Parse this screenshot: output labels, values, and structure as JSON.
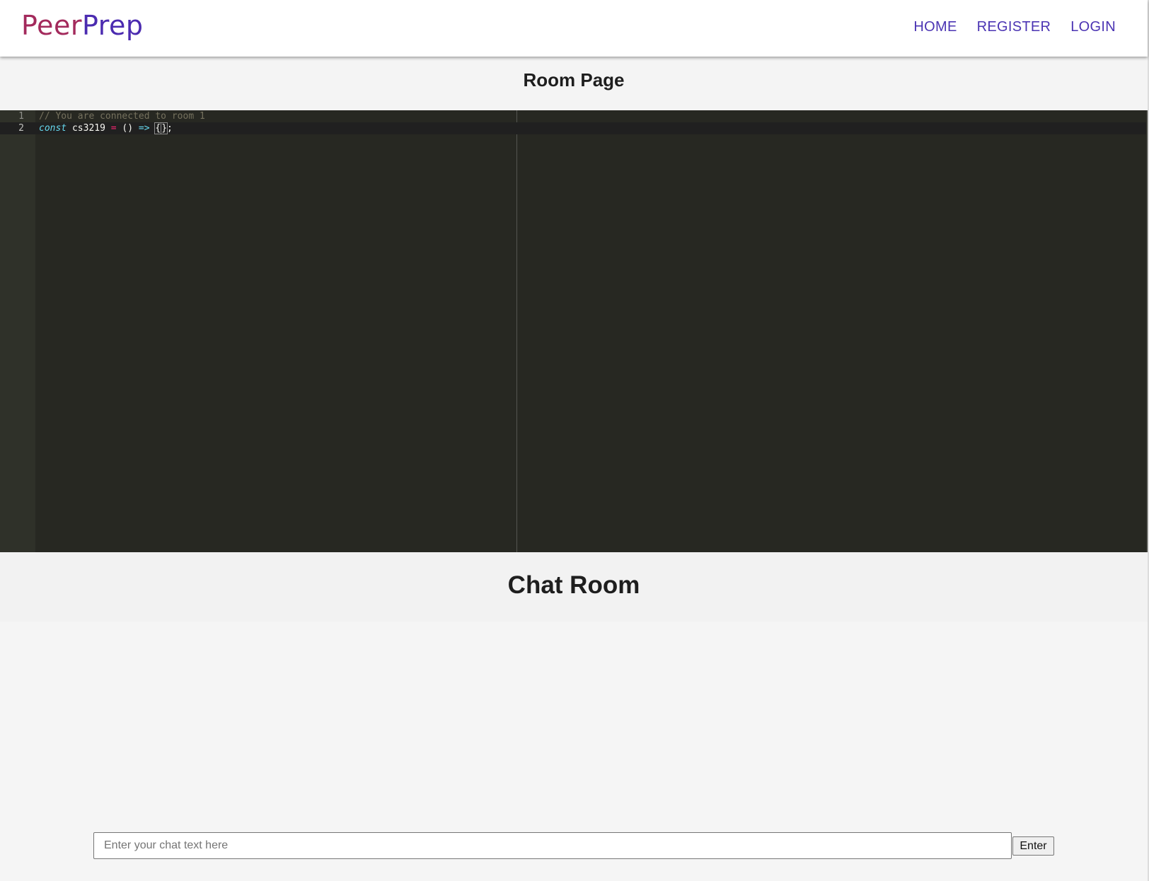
{
  "navbar": {
    "logo_part1": "Peer",
    "logo_part2": "Prep",
    "links": [
      "HOME",
      "REGISTER",
      "LOGIN"
    ]
  },
  "room": {
    "title": "Room Page"
  },
  "editor": {
    "lines": [
      {
        "number": "1",
        "comment": "// You are connected to room 1"
      },
      {
        "number": "2",
        "keyword": "const",
        "identifier": "cs3219",
        "assign": "=",
        "parens": "()",
        "arrow": "=>",
        "brace_open": "{",
        "brace_close": "}",
        "semicolon": ";"
      }
    ]
  },
  "chat": {
    "title": "Chat Room",
    "input_placeholder": "Enter your chat text here",
    "enter_label": "Enter"
  },
  "colors": {
    "logo_peer": "#a32a5c",
    "logo_prep": "#4b2bb0",
    "nav_link": "#4b34b3",
    "editor_bg": "#272822"
  }
}
